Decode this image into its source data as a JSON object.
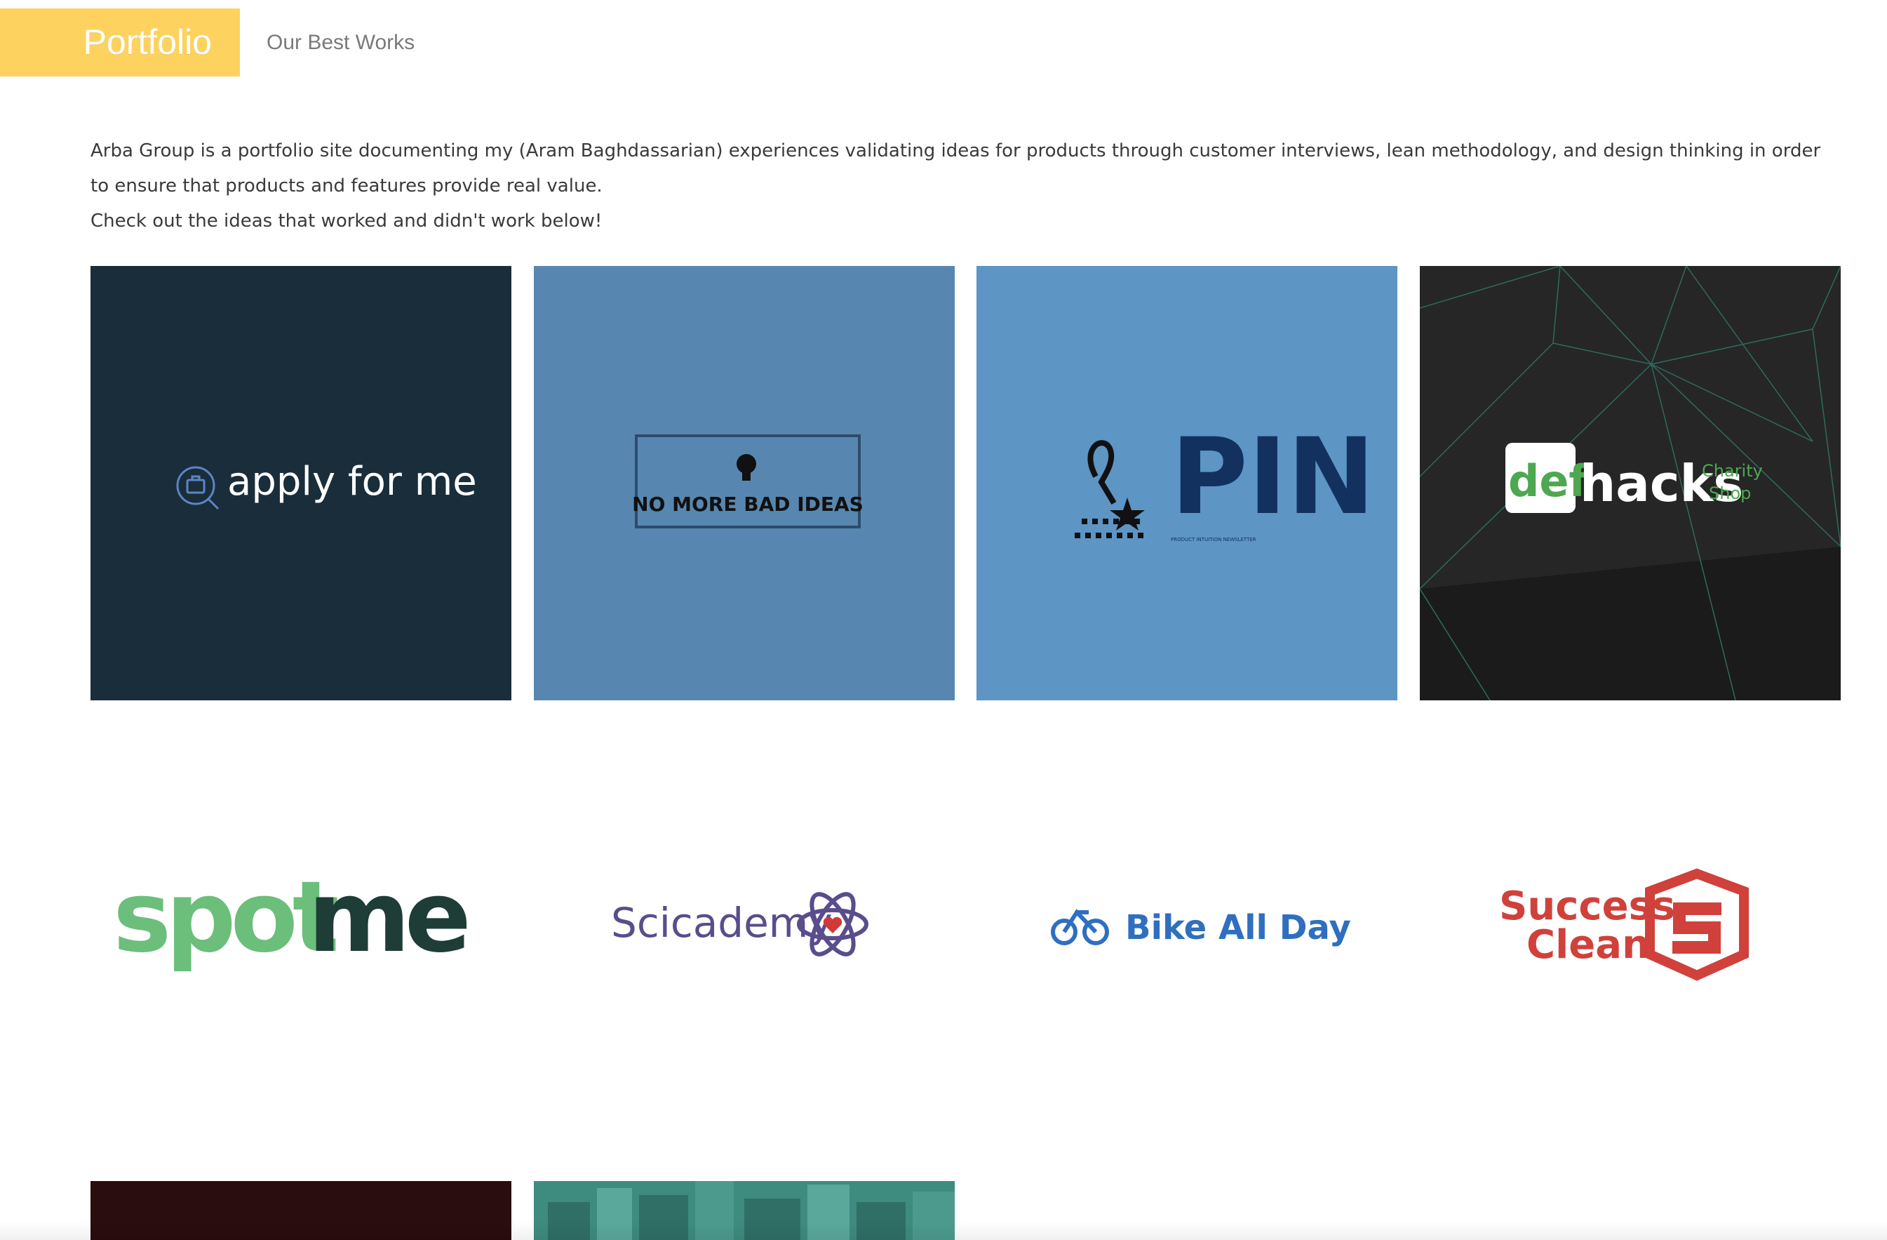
{
  "header": {
    "title": "Portfolio",
    "subtitle": "Our Best Works"
  },
  "intro": {
    "paragraph_1": "Arba Group is a portfolio site documenting my (Aram Baghdassarian) experiences validating ideas for products through customer interviews, lean methodology, and design thinking in order to ensure that products and features provide real value.",
    "paragraph_2": "Check out the ideas that worked and didn't work below!"
  },
  "projects": [
    {
      "name": "apply for me",
      "bg": "#1a2d3a",
      "icon": "briefcase-search-icon"
    },
    {
      "name": "NO MORE BAD IDEAS",
      "bg": "#5787b0",
      "icon": "lightbulb-icon"
    },
    {
      "name": "PIN",
      "tagline": "PRODUCT INTUITION NEWSLETTER",
      "bg": "#5d95c5",
      "icon": "pin-ribbon-star-icon"
    },
    {
      "name_part_1": "def",
      "name_part_2": "hacks",
      "name_part_3": "Charity",
      "name_part_4": "Shop",
      "bg": "#1b1b1b"
    }
  ],
  "logos": [
    {
      "part_1": "spot",
      "part_2": "me",
      "color_1": "#6cbe7b",
      "color_2": "#1f3d37"
    },
    {
      "name": "Scicademy",
      "color": "#5a4d8c",
      "icon": "atom-heart-icon"
    },
    {
      "name": "Bike All Day",
      "color": "#2f6fbf",
      "icon": "bicycle-icon"
    },
    {
      "line_1": "Success",
      "line_2": "Clean",
      "color": "#d0413b",
      "icon": "shield-s-icon"
    }
  ]
}
